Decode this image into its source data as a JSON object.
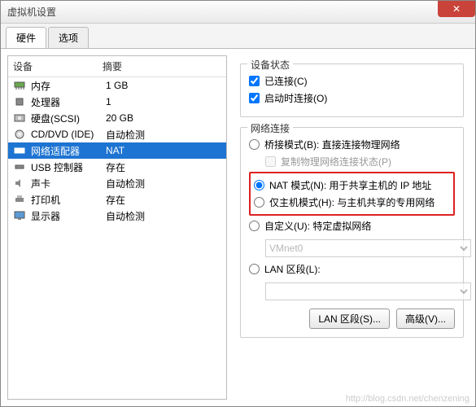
{
  "title": "虚拟机设置",
  "tabs": {
    "hardware": "硬件",
    "options": "选项"
  },
  "columns": {
    "device": "设备",
    "summary": "摘要"
  },
  "devices": [
    {
      "icon": "memory-icon",
      "name": "内存",
      "summary": "1 GB"
    },
    {
      "icon": "cpu-icon",
      "name": "处理器",
      "summary": "1"
    },
    {
      "icon": "disk-icon",
      "name": "硬盘(SCSI)",
      "summary": "20 GB"
    },
    {
      "icon": "cd-icon",
      "name": "CD/DVD (IDE)",
      "summary": "自动检测"
    },
    {
      "icon": "nic-icon",
      "name": "网络适配器",
      "summary": "NAT"
    },
    {
      "icon": "usb-icon",
      "name": "USB 控制器",
      "summary": "存在"
    },
    {
      "icon": "sound-icon",
      "name": "声卡",
      "summary": "自动检测"
    },
    {
      "icon": "printer-icon",
      "name": "打印机",
      "summary": "存在"
    },
    {
      "icon": "display-icon",
      "name": "显示器",
      "summary": "自动检测"
    }
  ],
  "selected_index": 4,
  "device_state": {
    "legend": "设备状态",
    "connected": "已连接(C)",
    "connect_at_poweron": "启动时连接(O)"
  },
  "net": {
    "legend": "网络连接",
    "bridged": "桥接模式(B): 直接连接物理网络",
    "replicate": "复制物理网络连接状态(P)",
    "nat": "NAT 模式(N): 用于共享主机的 IP 地址",
    "hostonly": "仅主机模式(H): 与主机共享的专用网络",
    "custom": "自定义(U): 特定虚拟网络",
    "custom_value": "VMnet0",
    "lan_segment": "LAN 区段(L):",
    "lan_value": ""
  },
  "buttons": {
    "lan": "LAN 区段(S)...",
    "advanced": "高级(V)..."
  },
  "watermark": "http://blog.csdn.net/chenzening"
}
